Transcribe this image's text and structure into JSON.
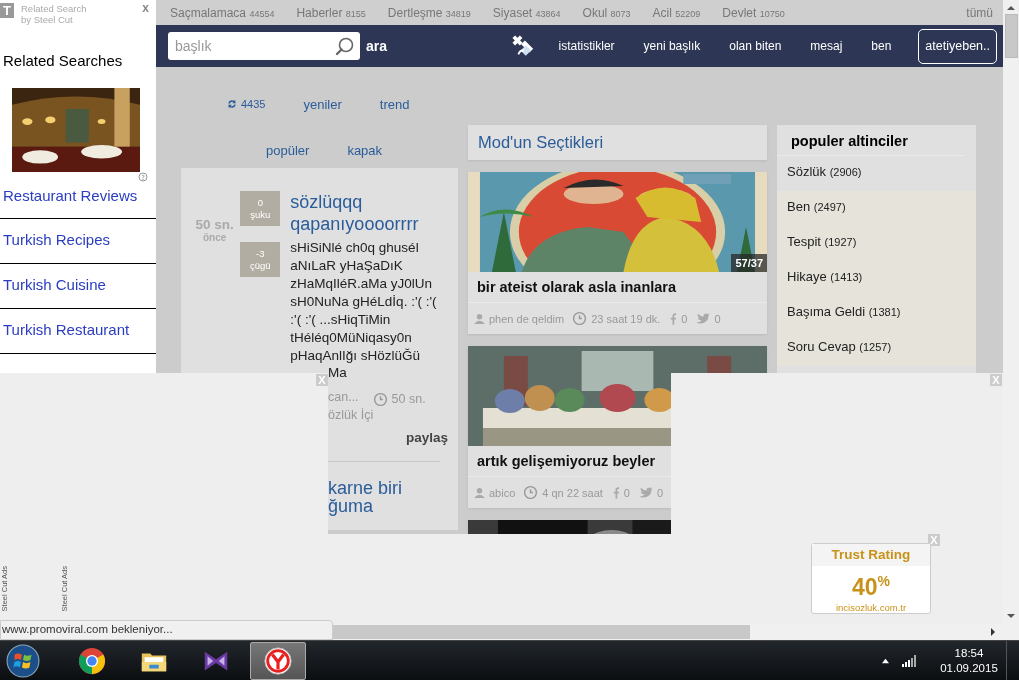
{
  "ad_sidebar": {
    "logo": "T",
    "title": "Related Search",
    "subtitle": "by Steel Cut",
    "close": "x",
    "heading": "Related Searches",
    "image": {
      "kind": "picture"
    },
    "links": [
      "Restaurant Reviews",
      "Turkish Recipes",
      "Turkish Cuisine",
      "Turkish Restaurant"
    ]
  },
  "categories": [
    {
      "name": "Saçmalamaca",
      "count": "44554"
    },
    {
      "name": "Haberler",
      "count": "8155"
    },
    {
      "name": "Dertleşme",
      "count": "34819"
    },
    {
      "name": "Siyaset",
      "count": "43864"
    },
    {
      "name": "Okul",
      "count": "8073"
    },
    {
      "name": "Acil",
      "count": "52209"
    },
    {
      "name": "Devlet",
      "count": "10750"
    }
  ],
  "all_link": "tümü",
  "header": {
    "search": {
      "placeholder": "başlık"
    },
    "search_button": "ara",
    "nav": [
      "istatistikler",
      "yeni başlık",
      "olan biten",
      "mesaj",
      "ben"
    ],
    "user": "atetiyeben.."
  },
  "feed_tabs": [
    {
      "label": "4435",
      "kind": "refresh"
    },
    {
      "label": "yeniler",
      "kind": "text"
    },
    {
      "label": "trend",
      "kind": "text"
    }
  ],
  "feed_tabs_secondary": [
    {
      "label": "popüler",
      "kind": "text"
    },
    {
      "label": "kapak",
      "kind": "text"
    }
  ],
  "latest_entry": {
    "time": "50 sn.",
    "time_suffix": "önce",
    "votes": [
      {
        "count": "0",
        "label": "şuku"
      },
      {
        "count": "-3",
        "label": "çügü"
      }
    ],
    "title": "sözlüqqq qapanıyoooorrrr",
    "body": "sHiSiNlé ch0q ghusél aNıLaR yHaŞaDıK zHaMqIléR.aMa yJ0lUn sH0NuNa gHéLdİq. :'( :'( :'( :'( ...sHiqTiMin tHéléq0MüNiqasy0n pHaqAnlIğı sHözlüĞü",
    "body_tail": "Ma",
    "author": "can...",
    "age": "50 sn.",
    "channel": "özlük İçi",
    "share": "paylaş"
  },
  "next_entry": {
    "title": "karne biri ğuma"
  },
  "mod_picks": {
    "title": "Mod'un Seçtikleri",
    "posts": [
      {
        "picture": {
          "kind": "picture"
        },
        "badge": "57/37",
        "title": "bir ateist olarak asla inanlara",
        "author": "phen de qeldim",
        "age": "23 saat 19 dk.",
        "facebook": "0",
        "twitter": "0"
      },
      {
        "picture": {
          "kind": "picture"
        },
        "title": "artık gelişemiyoruz beyler",
        "author": "abico",
        "age": "4 qn 22 saat",
        "facebook": "0",
        "twitter": "0"
      },
      {
        "picture": {
          "kind": "picture"
        }
      }
    ]
  },
  "popular": {
    "title": "populer altinciler",
    "items": [
      {
        "name": "Sözlük",
        "count": "(2906)"
      },
      {
        "name": "Ben",
        "count": "(2497)"
      },
      {
        "name": "Tespit",
        "count": "(1927)"
      },
      {
        "name": "Hikaye",
        "count": "(1413)"
      },
      {
        "name": "Başıma Geldi",
        "count": "(1381)"
      },
      {
        "name": "Soru Cevap",
        "count": "(1257)"
      }
    ]
  },
  "overlay_closes": [
    "X",
    "X"
  ],
  "side_ads": [
    "Steel Cut Ads",
    "Steel Cut Ads"
  ],
  "trust_rating": {
    "close": "X",
    "title": "Trust Rating",
    "value": "40",
    "unit": "%",
    "site": "incisozluk.com.tr"
  },
  "status": "www.promoviral.com bekleniyor...",
  "taskbar": {
    "apps": [
      {
        "kind": "chrome",
        "selected": false
      },
      {
        "kind": "folder",
        "selected": false
      },
      {
        "kind": "bowtie",
        "selected": false
      },
      {
        "kind": "yandex",
        "selected": true
      }
    ],
    "time": "18:54",
    "date": "01.09.2015"
  }
}
